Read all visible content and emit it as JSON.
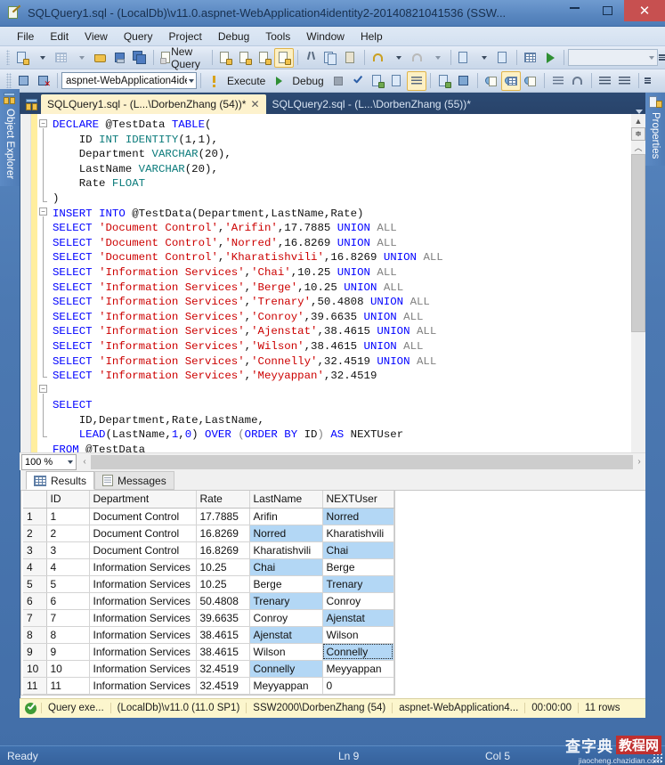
{
  "window": {
    "title": "SQLQuery1.sql - (LocalDb)\\v11.0.aspnet-WebApplication4identity2-20140821041536 (SSW...",
    "app_icon": "sql-query-file-icon",
    "minimize_label": "–",
    "maximize_label": "□",
    "close_label": "✕"
  },
  "menu": {
    "items": [
      "File",
      "Edit",
      "View",
      "Query",
      "Project",
      "Debug",
      "Tools",
      "Window",
      "Help"
    ]
  },
  "toolbar_standard": {
    "new_query_label": "New Query",
    "buttons": [
      {
        "name": "new-item-icon",
        "on": false
      },
      {
        "name": "new-project-icon",
        "on": false
      },
      {
        "name": "open-file-icon",
        "on": false
      },
      {
        "name": "save-icon",
        "on": false
      },
      {
        "name": "save-all-icon",
        "on": false
      },
      {
        "name": "new-query-icon",
        "on": false
      },
      {
        "name": "new-database-engine-query-icon",
        "on": false
      },
      {
        "name": "new-analysis-services-mdx-query-icon",
        "on": false
      },
      {
        "name": "new-analysis-services-dmx-query-icon",
        "on": false
      },
      {
        "name": "new-analysis-services-xmla-query-icon",
        "on": true
      },
      {
        "name": "cut-icon",
        "on": false
      },
      {
        "name": "copy-icon",
        "on": false
      },
      {
        "name": "paste-icon",
        "on": false
      },
      {
        "name": "undo-icon",
        "on": false
      },
      {
        "name": "redo-icon",
        "on": false
      },
      {
        "name": "navigate-backward-icon",
        "on": false
      },
      {
        "name": "navigate-forward-icon",
        "on": false
      },
      {
        "name": "find-in-files-icon",
        "on": false
      },
      {
        "name": "start-debug-icon",
        "on": false
      }
    ],
    "find_combo_value": ""
  },
  "toolbar_editor": {
    "database_value": "aspnet-WebApplication4ide",
    "execute_label": "Execute",
    "debug_label": "Debug",
    "buttons": [
      {
        "name": "connect-icon",
        "on": false
      },
      {
        "name": "disconnect-icon",
        "on": false
      },
      {
        "name": "parse-query-icon",
        "on": false
      },
      {
        "name": "stop-icon",
        "on": false
      },
      {
        "name": "check-syntax-icon",
        "on": false
      },
      {
        "name": "display-estimated-execution-plan-icon",
        "on": false
      },
      {
        "name": "query-options-icon",
        "on": false
      },
      {
        "name": "include-actual-execution-plan-icon",
        "on": true
      },
      {
        "name": "include-client-statistics-icon",
        "on": false
      },
      {
        "name": "intellisense-icon",
        "on": false
      },
      {
        "name": "results-to-text-icon",
        "on": false
      },
      {
        "name": "results-to-grid-icon",
        "on": true
      },
      {
        "name": "results-to-file-icon",
        "on": false
      },
      {
        "name": "comment-lines-icon",
        "on": false
      },
      {
        "name": "uncomment-lines-icon",
        "on": false
      },
      {
        "name": "decrease-indent-icon",
        "on": false
      },
      {
        "name": "increase-indent-icon",
        "on": false
      }
    ]
  },
  "tabs": {
    "items": [
      {
        "label": "SQLQuery1.sql - (L...\\DorbenZhang (54))*",
        "active": true,
        "close": "✕"
      },
      {
        "label": "SQLQuery2.sql - (L...\\DorbenZhang (55))*",
        "active": false,
        "close": ""
      }
    ]
  },
  "editor": {
    "zoom_value": "100 %",
    "lines": [
      [
        {
          "t": "DECLARE",
          "c": "kw"
        },
        {
          "t": " @TestData ",
          "c": "num"
        },
        {
          "t": "TABLE",
          "c": "kw"
        },
        {
          "t": "(",
          "c": "num"
        }
      ],
      [
        {
          "t": "    ID ",
          "c": "num"
        },
        {
          "t": "INT",
          "c": "tp"
        },
        {
          "t": " ",
          "c": "num"
        },
        {
          "t": "IDENTITY",
          "c": "tp"
        },
        {
          "t": "(1,1),",
          "c": "num"
        }
      ],
      [
        {
          "t": "    Department ",
          "c": "num"
        },
        {
          "t": "VARCHAR",
          "c": "tp"
        },
        {
          "t": "(20),",
          "c": "num"
        }
      ],
      [
        {
          "t": "    LastName ",
          "c": "num"
        },
        {
          "t": "VARCHAR",
          "c": "tp"
        },
        {
          "t": "(20),",
          "c": "num"
        }
      ],
      [
        {
          "t": "    Rate ",
          "c": "num"
        },
        {
          "t": "FLOAT",
          "c": "tp"
        }
      ],
      [
        {
          "t": ")",
          "c": "num"
        }
      ],
      [
        {
          "t": "INSERT",
          "c": "kw"
        },
        {
          "t": " ",
          "c": "num"
        },
        {
          "t": "INTO",
          "c": "kw"
        },
        {
          "t": " @TestData(Department,LastName,Rate)",
          "c": "num"
        }
      ],
      [
        {
          "t": "SELECT",
          "c": "kw"
        },
        {
          "t": " ",
          "c": "num"
        },
        {
          "t": "'Document Control'",
          "c": "str"
        },
        {
          "t": ",",
          "c": "num"
        },
        {
          "t": "'Arifin'",
          "c": "str"
        },
        {
          "t": ",17.7885 ",
          "c": "num"
        },
        {
          "t": "UNION",
          "c": "kw"
        },
        {
          "t": " ",
          "c": "num"
        },
        {
          "t": "ALL",
          "c": "gy"
        }
      ],
      [
        {
          "t": "SELECT",
          "c": "kw"
        },
        {
          "t": " ",
          "c": "num"
        },
        {
          "t": "'Document Control'",
          "c": "str"
        },
        {
          "t": ",",
          "c": "num"
        },
        {
          "t": "'Norred'",
          "c": "str"
        },
        {
          "t": ",16.8269 ",
          "c": "num"
        },
        {
          "t": "UNION",
          "c": "kw"
        },
        {
          "t": " ",
          "c": "num"
        },
        {
          "t": "ALL",
          "c": "gy"
        }
      ],
      [
        {
          "t": "SELECT",
          "c": "kw"
        },
        {
          "t": " ",
          "c": "num"
        },
        {
          "t": "'Document Control'",
          "c": "str"
        },
        {
          "t": ",",
          "c": "num"
        },
        {
          "t": "'Kharatishvili'",
          "c": "str"
        },
        {
          "t": ",16.8269 ",
          "c": "num"
        },
        {
          "t": "UNION",
          "c": "kw"
        },
        {
          "t": " ",
          "c": "num"
        },
        {
          "t": "ALL",
          "c": "gy"
        }
      ],
      [
        {
          "t": "SELECT",
          "c": "kw"
        },
        {
          "t": " ",
          "c": "num"
        },
        {
          "t": "'Information Services'",
          "c": "str"
        },
        {
          "t": ",",
          "c": "num"
        },
        {
          "t": "'Chai'",
          "c": "str"
        },
        {
          "t": ",10.25 ",
          "c": "num"
        },
        {
          "t": "UNION",
          "c": "kw"
        },
        {
          "t": " ",
          "c": "num"
        },
        {
          "t": "ALL",
          "c": "gy"
        }
      ],
      [
        {
          "t": "SELECT",
          "c": "kw"
        },
        {
          "t": " ",
          "c": "num"
        },
        {
          "t": "'Information Services'",
          "c": "str"
        },
        {
          "t": ",",
          "c": "num"
        },
        {
          "t": "'Berge'",
          "c": "str"
        },
        {
          "t": ",10.25 ",
          "c": "num"
        },
        {
          "t": "UNION",
          "c": "kw"
        },
        {
          "t": " ",
          "c": "num"
        },
        {
          "t": "ALL",
          "c": "gy"
        }
      ],
      [
        {
          "t": "SELECT",
          "c": "kw"
        },
        {
          "t": " ",
          "c": "num"
        },
        {
          "t": "'Information Services'",
          "c": "str"
        },
        {
          "t": ",",
          "c": "num"
        },
        {
          "t": "'Trenary'",
          "c": "str"
        },
        {
          "t": ",50.4808 ",
          "c": "num"
        },
        {
          "t": "UNION",
          "c": "kw"
        },
        {
          "t": " ",
          "c": "num"
        },
        {
          "t": "ALL",
          "c": "gy"
        }
      ],
      [
        {
          "t": "SELECT",
          "c": "kw"
        },
        {
          "t": " ",
          "c": "num"
        },
        {
          "t": "'Information Services'",
          "c": "str"
        },
        {
          "t": ",",
          "c": "num"
        },
        {
          "t": "'Conroy'",
          "c": "str"
        },
        {
          "t": ",39.6635 ",
          "c": "num"
        },
        {
          "t": "UNION",
          "c": "kw"
        },
        {
          "t": " ",
          "c": "num"
        },
        {
          "t": "ALL",
          "c": "gy"
        }
      ],
      [
        {
          "t": "SELECT",
          "c": "kw"
        },
        {
          "t": " ",
          "c": "num"
        },
        {
          "t": "'Information Services'",
          "c": "str"
        },
        {
          "t": ",",
          "c": "num"
        },
        {
          "t": "'Ajenstat'",
          "c": "str"
        },
        {
          "t": ",38.4615 ",
          "c": "num"
        },
        {
          "t": "UNION",
          "c": "kw"
        },
        {
          "t": " ",
          "c": "num"
        },
        {
          "t": "ALL",
          "c": "gy"
        }
      ],
      [
        {
          "t": "SELECT",
          "c": "kw"
        },
        {
          "t": " ",
          "c": "num"
        },
        {
          "t": "'Information Services'",
          "c": "str"
        },
        {
          "t": ",",
          "c": "num"
        },
        {
          "t": "'Wilson'",
          "c": "str"
        },
        {
          "t": ",38.4615 ",
          "c": "num"
        },
        {
          "t": "UNION",
          "c": "kw"
        },
        {
          "t": " ",
          "c": "num"
        },
        {
          "t": "ALL",
          "c": "gy"
        }
      ],
      [
        {
          "t": "SELECT",
          "c": "kw"
        },
        {
          "t": " ",
          "c": "num"
        },
        {
          "t": "'Information Services'",
          "c": "str"
        },
        {
          "t": ",",
          "c": "num"
        },
        {
          "t": "'Connelly'",
          "c": "str"
        },
        {
          "t": ",32.4519 ",
          "c": "num"
        },
        {
          "t": "UNION",
          "c": "kw"
        },
        {
          "t": " ",
          "c": "num"
        },
        {
          "t": "ALL",
          "c": "gy"
        }
      ],
      [
        {
          "t": "SELECT",
          "c": "kw"
        },
        {
          "t": " ",
          "c": "num"
        },
        {
          "t": "'Information Services'",
          "c": "str"
        },
        {
          "t": ",",
          "c": "num"
        },
        {
          "t": "'Meyyappan'",
          "c": "str"
        },
        {
          "t": ",32.4519",
          "c": "num"
        }
      ],
      [
        {
          "t": "",
          "c": "num"
        }
      ],
      [
        {
          "t": "SELECT",
          "c": "kw"
        }
      ],
      [
        {
          "t": "    ID,Department,Rate,LastName,",
          "c": "num"
        }
      ],
      [
        {
          "t": "    ",
          "c": "num"
        },
        {
          "t": "LEAD",
          "c": "kw"
        },
        {
          "t": "(LastName,",
          "c": "num"
        },
        {
          "t": "1",
          "c": "kw"
        },
        {
          "t": ",",
          "c": "num"
        },
        {
          "t": "0",
          "c": "kw"
        },
        {
          "t": ") ",
          "c": "num"
        },
        {
          "t": "OVER",
          "c": "kw"
        },
        {
          "t": " ",
          "c": "num"
        },
        {
          "t": "(",
          "c": "gy"
        },
        {
          "t": "ORDER",
          "c": "kw"
        },
        {
          "t": " ",
          "c": "num"
        },
        {
          "t": "BY",
          "c": "kw"
        },
        {
          "t": " ",
          "c": "num"
        },
        {
          "t": "ID",
          "c": "num"
        },
        {
          "t": ")",
          "c": "gy"
        },
        {
          "t": " ",
          "c": "num"
        },
        {
          "t": "AS",
          "c": "kw"
        },
        {
          "t": " NEXTUser",
          "c": "num"
        }
      ],
      [
        {
          "t": "FROM",
          "c": "kw"
        },
        {
          "t": " @TestData",
          "c": "num"
        }
      ]
    ]
  },
  "results": {
    "tabs": [
      {
        "label": "Results",
        "icon": "results-grid-icon",
        "active": true
      },
      {
        "label": "Messages",
        "icon": "messages-icon",
        "active": false
      }
    ],
    "columns": [
      "",
      "ID",
      "Department",
      "Rate",
      "LastName",
      "NEXTUser"
    ],
    "rows": [
      {
        "n": "1",
        "ID": "1",
        "Department": "Document Control",
        "Rate": "17.7885",
        "LastName": "Arifin",
        "NEXTUser": "Norred",
        "sel": "NEXTUser"
      },
      {
        "n": "2",
        "ID": "2",
        "Department": "Document Control",
        "Rate": "16.8269",
        "LastName": "Norred",
        "NEXTUser": "Kharatishvili",
        "sel": "LastName"
      },
      {
        "n": "3",
        "ID": "3",
        "Department": "Document Control",
        "Rate": "16.8269",
        "LastName": "Kharatishvili",
        "NEXTUser": "Chai",
        "sel": "NEXTUser"
      },
      {
        "n": "4",
        "ID": "4",
        "Department": "Information Services",
        "Rate": "10.25",
        "LastName": "Chai",
        "NEXTUser": "Berge",
        "sel": "LastName"
      },
      {
        "n": "5",
        "ID": "5",
        "Department": "Information Services",
        "Rate": "10.25",
        "LastName": "Berge",
        "NEXTUser": "Trenary",
        "sel": "NEXTUser"
      },
      {
        "n": "6",
        "ID": "6",
        "Department": "Information Services",
        "Rate": "50.4808",
        "LastName": "Trenary",
        "NEXTUser": "Conroy",
        "sel": "LastName"
      },
      {
        "n": "7",
        "ID": "7",
        "Department": "Information Services",
        "Rate": "39.6635",
        "LastName": "Conroy",
        "NEXTUser": "Ajenstat",
        "sel": "NEXTUser"
      },
      {
        "n": "8",
        "ID": "8",
        "Department": "Information Services",
        "Rate": "38.4615",
        "LastName": "Ajenstat",
        "NEXTUser": "Wilson",
        "sel": "LastName"
      },
      {
        "n": "9",
        "ID": "9",
        "Department": "Information Services",
        "Rate": "38.4615",
        "LastName": "Wilson",
        "NEXTUser": "Connelly",
        "sel": "NEXTUser-focus"
      },
      {
        "n": "10",
        "ID": "10",
        "Department": "Information Services",
        "Rate": "32.4519",
        "LastName": "Connelly",
        "NEXTUser": "Meyyappan",
        "sel": "LastName"
      },
      {
        "n": "11",
        "ID": "11",
        "Department": "Information Services",
        "Rate": "32.4519",
        "LastName": "Meyyappan",
        "NEXTUser": "0",
        "sel": ""
      }
    ]
  },
  "query_status": {
    "icon": "success-check-icon",
    "message": "Query exe...",
    "server": "(LocalDb)\\v11.0 (11.0 SP1)",
    "user": "SSW2000\\DorbenZhang (54)",
    "database": "aspnet-WebApplication4...",
    "elapsed": "00:00:00",
    "rows": "11 rows"
  },
  "statusbar": {
    "state": "Ready",
    "line": "Ln 9",
    "column": "Col 5"
  },
  "docks": {
    "left": {
      "label": "Object Explorer",
      "icon": "object-explorer-icon"
    },
    "right": {
      "label": "Properties",
      "icon": "properties-icon"
    }
  },
  "watermark": {
    "text1": "查字典",
    "text2": "教程网",
    "url": "jiaocheng.chazidian.com"
  }
}
